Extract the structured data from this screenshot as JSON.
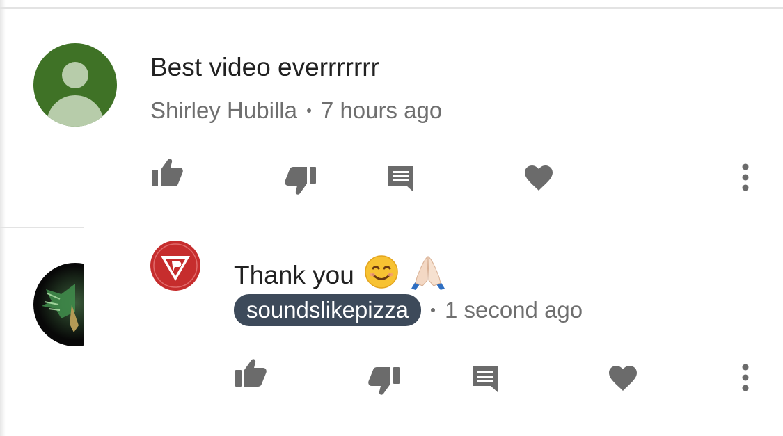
{
  "comments": [
    {
      "text": "Best video everrrrrrr",
      "author": "Shirley Hubilla",
      "time": "7 hours ago",
      "avatar_icon": "default-user-avatar-icon",
      "avatar_color": "#3f7226"
    },
    {
      "text": "Thank you",
      "emojis": [
        "smiling-face-emoji",
        "folded-hands-emoji"
      ],
      "author": "soundslikepizza",
      "author_badge_color": "#3d4a5a",
      "time": "1 second ago",
      "avatar_icon": "pizza-logo-icon",
      "avatar_color": "#c62d2d"
    }
  ],
  "actions": [
    "thumbs-up-icon",
    "thumbs-down-icon",
    "reply-icon",
    "heart-icon",
    "more-vert-icon"
  ],
  "colors": {
    "icon_gray": "#6b6b6b",
    "meta_gray": "#6f6f6f",
    "divider": "#e3e3e3"
  }
}
